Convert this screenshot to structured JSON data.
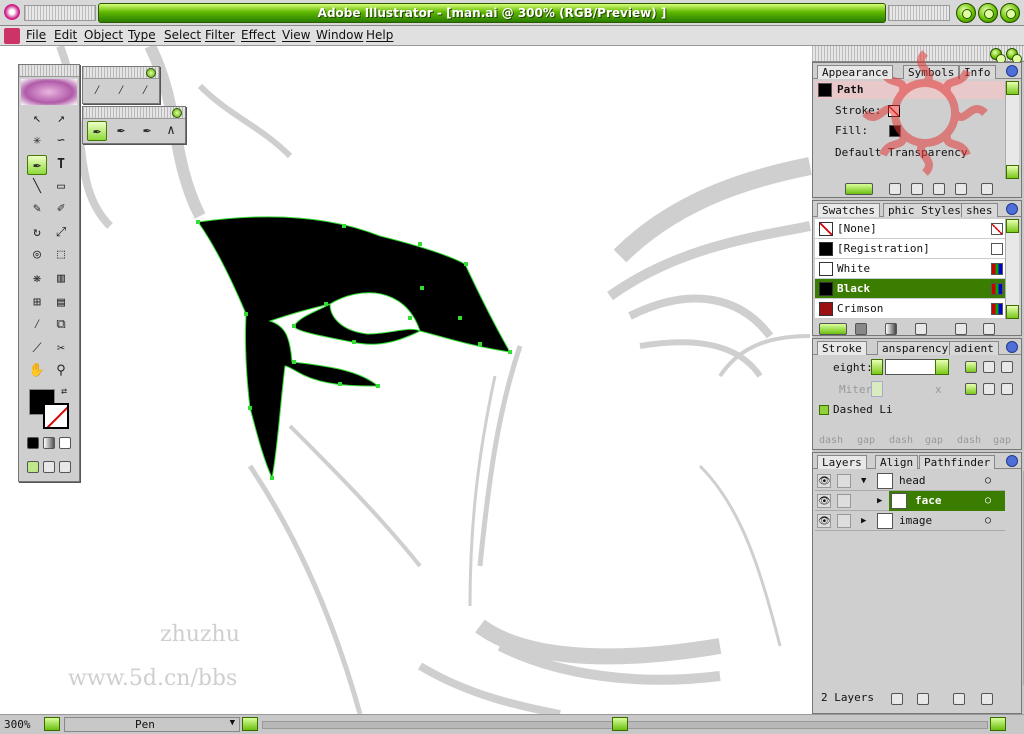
{
  "window": {
    "title": "Adobe Illustrator - [man.ai @ 300% (RGB/Preview) ]",
    "app_icon": "illustrator-flower-icon"
  },
  "menu": [
    "File",
    "Edit",
    "Object",
    "Type",
    "Select",
    "Filter",
    "Effect",
    "View",
    "Window",
    "Help"
  ],
  "canvas": {
    "watermark_name": "zhuzhu",
    "watermark_url": "www.5d.cn/bbs"
  },
  "status": {
    "zoom": "300%",
    "tool": "Pen"
  },
  "appearance": {
    "tabs": [
      "Appearance",
      "Symbols",
      "Info"
    ],
    "object": "Path",
    "stroke_label": "Stroke:",
    "fill_label": "Fill:",
    "transparency": "Default Transparency"
  },
  "swatches": {
    "tabs": [
      "Swatches",
      "phic Styles",
      "shes"
    ],
    "items": [
      {
        "name": "[None]",
        "color": "#ffffff",
        "none": true
      },
      {
        "name": "[Registration]",
        "color": "#000000"
      },
      {
        "name": "White",
        "color": "#ffffff"
      },
      {
        "name": "Black",
        "color": "#000000",
        "selected": true
      },
      {
        "name": "Crimson",
        "color": "#9b1010"
      }
    ]
  },
  "stroke": {
    "tabs": [
      "Stroke",
      "ansparency",
      "adient"
    ],
    "weight_label": "eight:",
    "miter_label": "Miter",
    "miter_unit": "x",
    "dashed_label": "Dashed Li",
    "dash_labels": [
      "dash",
      "gap",
      "dash",
      "gap",
      "dash",
      "gap"
    ]
  },
  "layers": {
    "tabs": [
      "Layers",
      "Align",
      "Pathfinder"
    ],
    "items": [
      {
        "name": "head",
        "level": 0,
        "selected": false
      },
      {
        "name": "face",
        "level": 1,
        "selected": true
      },
      {
        "name": "image",
        "level": 0,
        "selected": false
      }
    ],
    "count": "2 Layers"
  },
  "colors": {
    "accent": "#3a7d00",
    "title_green": "#5fb800",
    "canvas_bg": "#ffffff",
    "shape_fill": "#000000",
    "path_stroke": "#33dd33"
  }
}
